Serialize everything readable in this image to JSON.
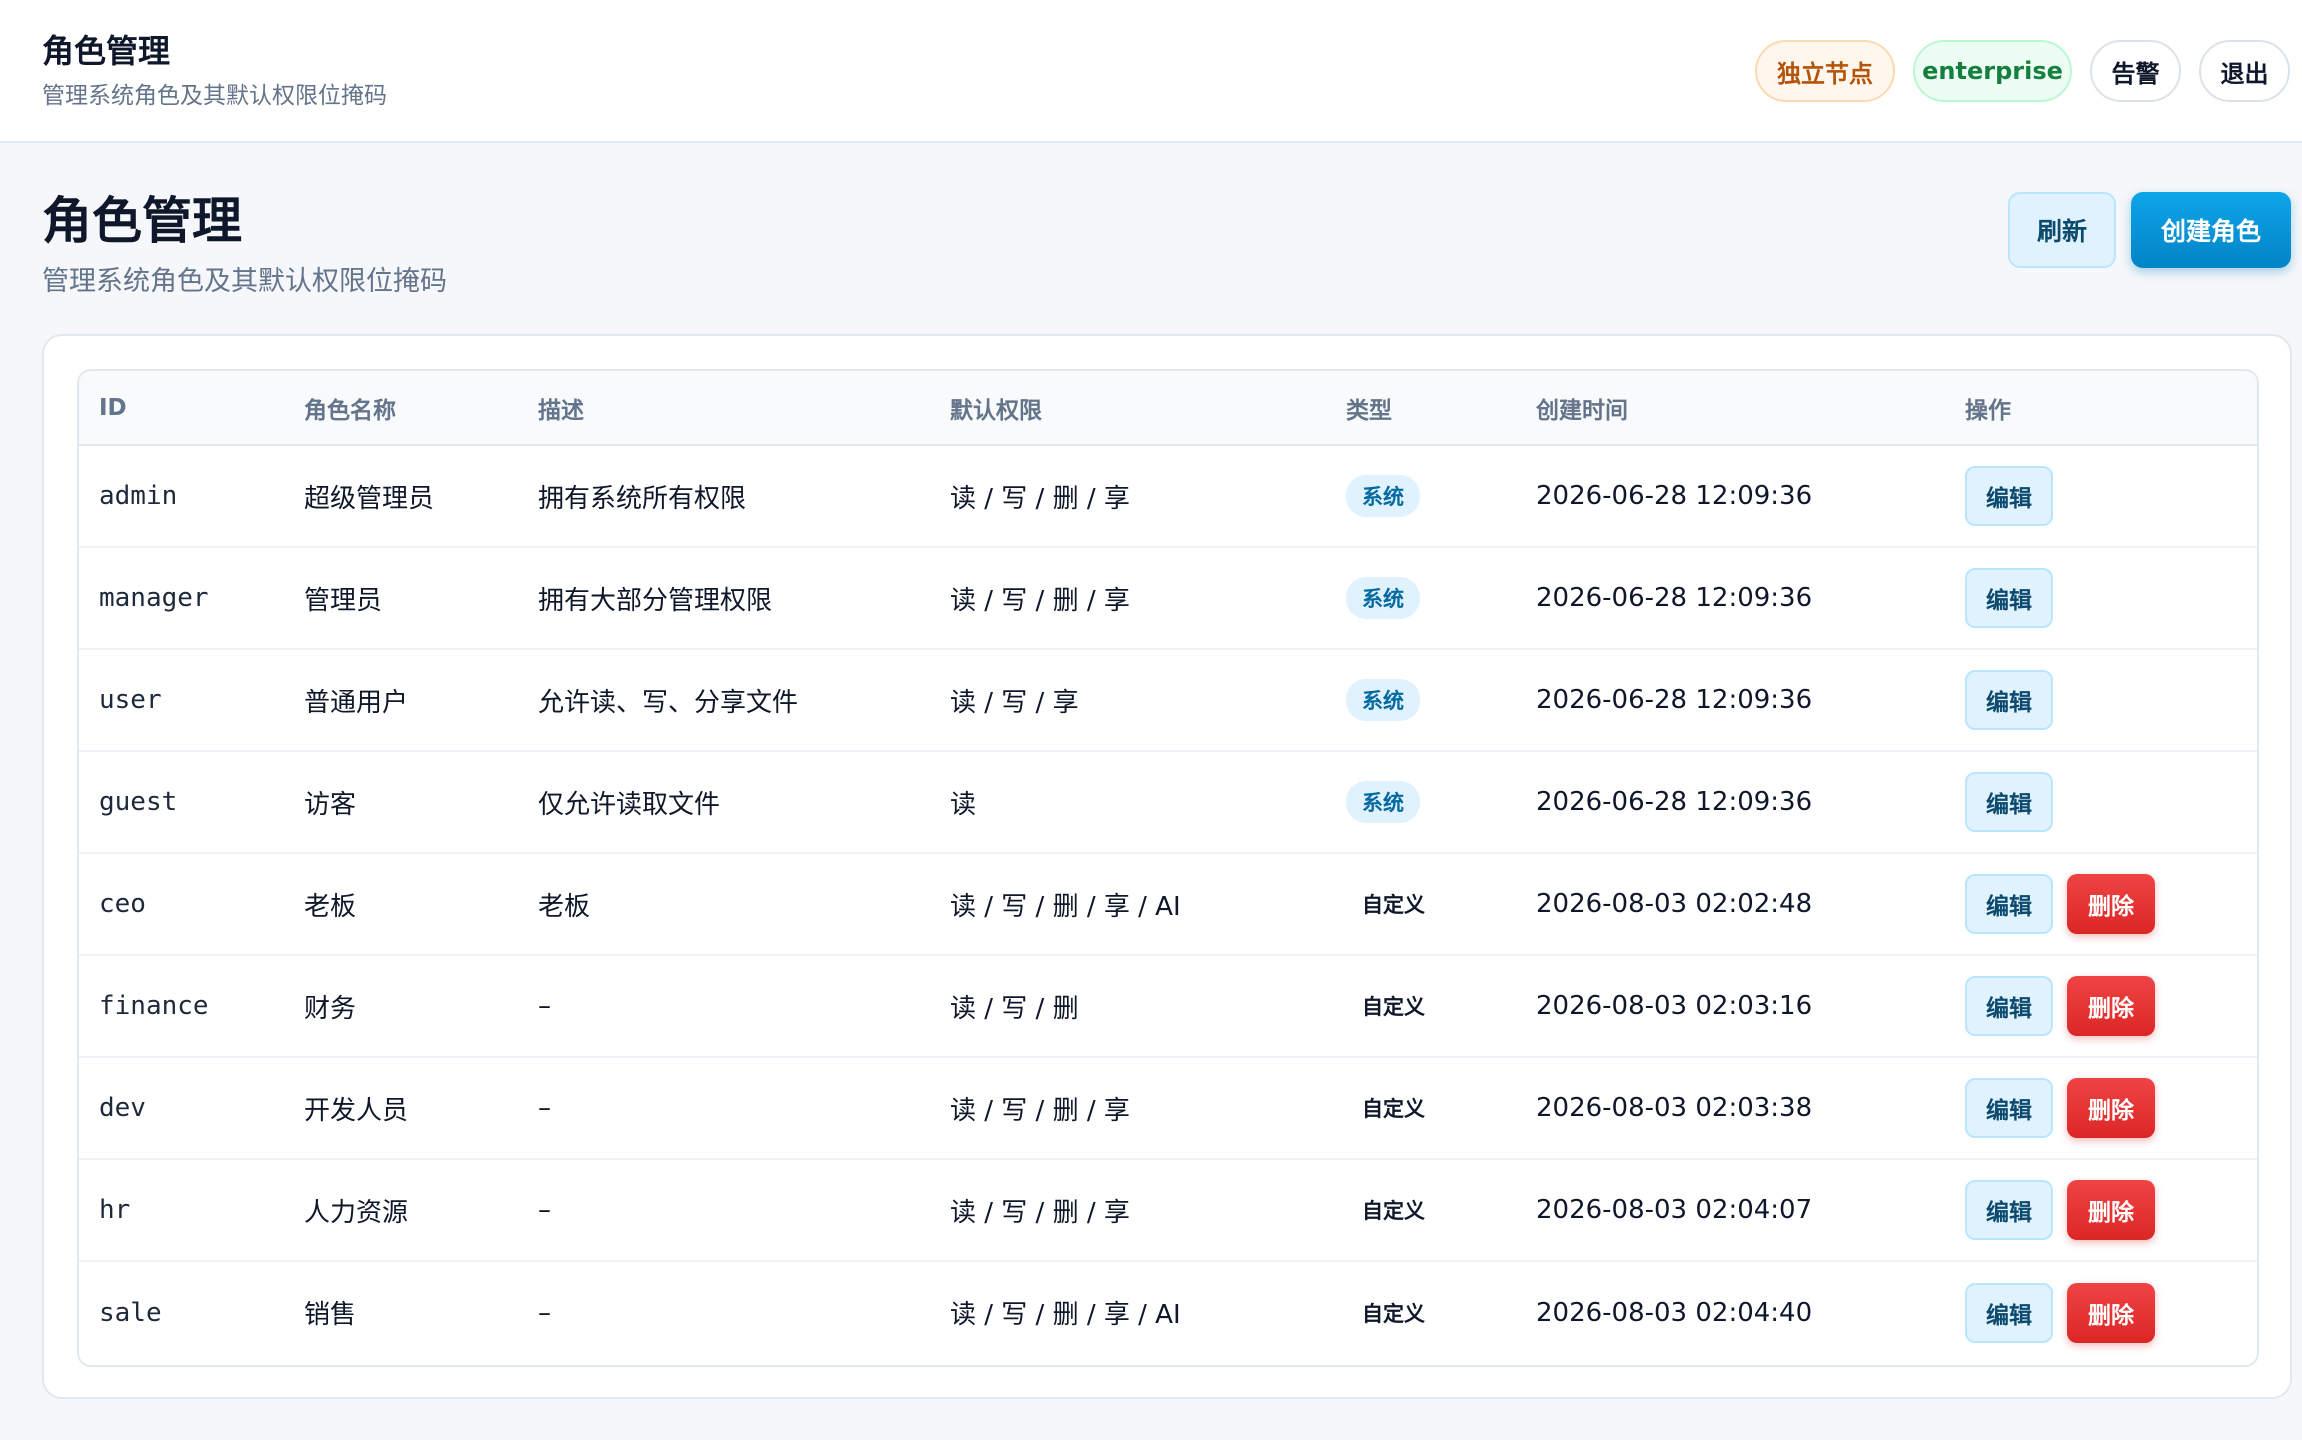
{
  "topbar": {
    "title": "角色管理",
    "subtitle": "管理系统角色及其默认权限位掩码",
    "node_badge": "独立节点",
    "edition_badge": "enterprise",
    "alerts_button": "告警",
    "logout_button": "退出"
  },
  "page": {
    "title": "角色管理",
    "subtitle": "管理系统角色及其默认权限位掩码",
    "refresh_button": "刷新",
    "create_button": "创建角色"
  },
  "table": {
    "headers": [
      "ID",
      "角色名称",
      "描述",
      "默认权限",
      "类型",
      "创建时间",
      "操作"
    ],
    "edit_label": "编辑",
    "delete_label": "删除",
    "rows": [
      {
        "id": "admin",
        "name": "超级管理员",
        "desc": "拥有系统所有权限",
        "perms": "读 / 写 / 删 / 享",
        "type": "系统",
        "system": true,
        "created": "2026-06-28 12:09:36"
      },
      {
        "id": "manager",
        "name": "管理员",
        "desc": "拥有大部分管理权限",
        "perms": "读 / 写 / 删 / 享",
        "type": "系统",
        "system": true,
        "created": "2026-06-28 12:09:36"
      },
      {
        "id": "user",
        "name": "普通用户",
        "desc": "允许读、写、分享文件",
        "perms": "读 / 写 / 享",
        "type": "系统",
        "system": true,
        "created": "2026-06-28 12:09:36"
      },
      {
        "id": "guest",
        "name": "访客",
        "desc": "仅允许读取文件",
        "perms": "读",
        "type": "系统",
        "system": true,
        "created": "2026-06-28 12:09:36"
      },
      {
        "id": "ceo",
        "name": "老板",
        "desc": "老板",
        "perms": "读 / 写 / 删 / 享 / AI",
        "type": "自定义",
        "system": false,
        "created": "2026-08-03 02:02:48"
      },
      {
        "id": "finance",
        "name": "财务",
        "desc": "–",
        "perms": "读 / 写 / 删",
        "type": "自定义",
        "system": false,
        "created": "2026-08-03 02:03:16"
      },
      {
        "id": "dev",
        "name": "开发人员",
        "desc": "–",
        "perms": "读 / 写 / 删 / 享",
        "type": "自定义",
        "system": false,
        "created": "2026-08-03 02:03:38"
      },
      {
        "id": "hr",
        "name": "人力资源",
        "desc": "–",
        "perms": "读 / 写 / 删 / 享",
        "type": "自定义",
        "system": false,
        "created": "2026-08-03 02:04:07"
      },
      {
        "id": "sale",
        "name": "销售",
        "desc": "–",
        "perms": "读 / 写 / 删 / 享 / AI",
        "type": "自定义",
        "system": false,
        "created": "2026-08-03 02:04:40"
      }
    ]
  }
}
